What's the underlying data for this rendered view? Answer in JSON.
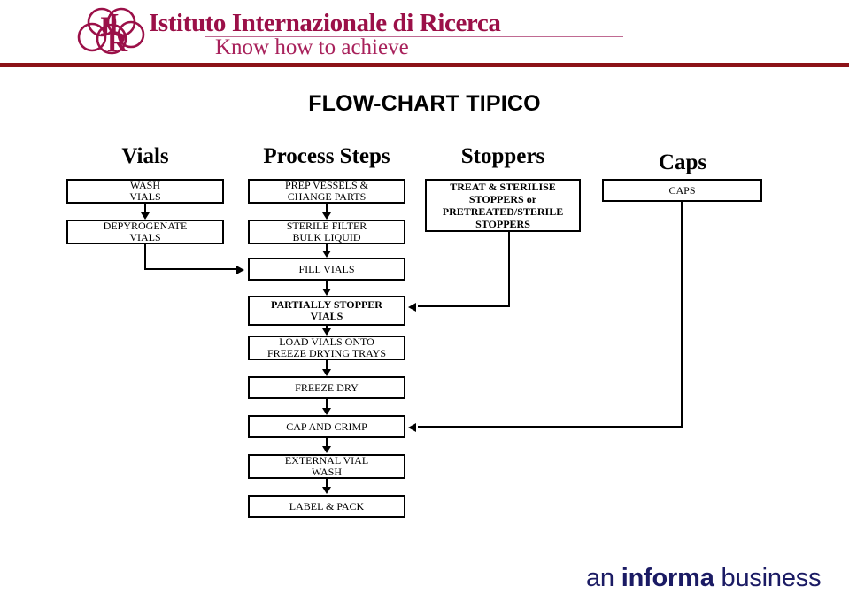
{
  "brand": {
    "logo_name": "iir-monogram-logo",
    "title": "Istituto Internazionale di Ricerca",
    "tagline": "Know how to achieve",
    "title_color": "#9b1048",
    "tagline_color": "#a8215b",
    "rule_color": "#8c1218"
  },
  "slide": {
    "title": "FLOW-CHART TIPICO"
  },
  "columns": [
    {
      "key": "vials",
      "label": "Vials"
    },
    {
      "key": "process",
      "label": "Process Steps"
    },
    {
      "key": "stoppers",
      "label": "Stoppers"
    },
    {
      "key": "caps",
      "label": "Caps"
    }
  ],
  "boxes": {
    "wash_vials": "WASH\nVIALS",
    "depyrogenate_vials": "DEPYROGENATE\nVIALS",
    "prep_vessels": "PREP VESSELS &\nCHANGE PARTS",
    "sterile_filter": "STERILE FILTER\nBULK LIQUID",
    "fill_vials": "FILL VIALS",
    "partially_stopper": "PARTIALLY STOPPER\nVIALS",
    "load_vials": "LOAD VIALS ONTO\nFREEZE DRYING TRAYS",
    "freeze_dry": "FREEZE DRY",
    "cap_and_crimp": "CAP AND CRIMP",
    "external_vial_wash": "EXTERNAL VIAL\nWASH",
    "label_and_pack": "LABEL & PACK",
    "treat_sterilise": "TREAT & STERILISE\nSTOPPERS or\nPRETREATED/STERILE\nSTOPPERS",
    "caps": "CAPS"
  },
  "footer": {
    "prefix": "an ",
    "brand": "informa",
    "suffix": " business",
    "color": "#1b1b64"
  }
}
